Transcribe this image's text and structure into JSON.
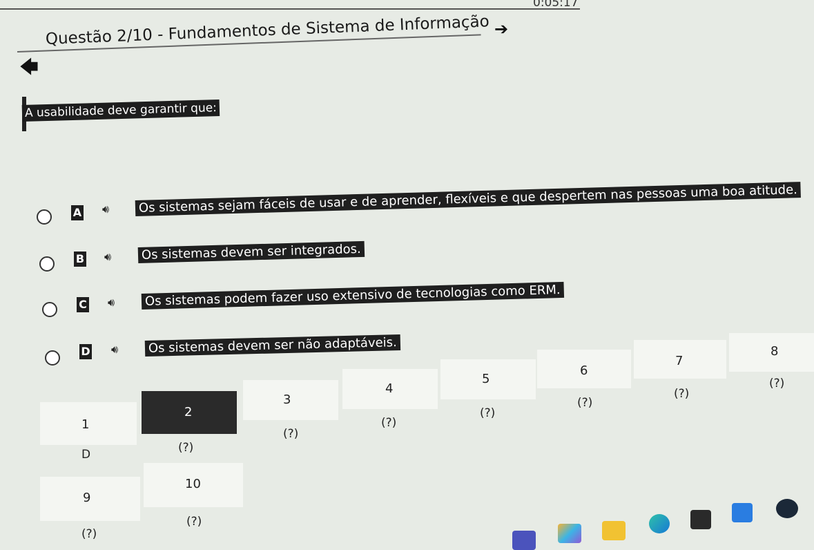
{
  "timer": "0:05:17",
  "header": {
    "title": "Questão 2/10 - Fundamentos de Sistema de Informação",
    "back_icon": "arrow-left-icon",
    "next_icon": "arrow-right-icon"
  },
  "question": {
    "text": "A usabilidade deve garantir que:"
  },
  "options": [
    {
      "letter": "A",
      "text": "Os sistemas sejam fáceis de usar e de aprender, flexíveis e que despertem nas pessoas uma boa atitude."
    },
    {
      "letter": "B",
      "text": "Os sistemas devem ser integrados."
    },
    {
      "letter": "C",
      "text": "Os sistemas podem fazer uso extensivo de tecnologias como ERM."
    },
    {
      "letter": "D",
      "text": "Os sistemas devem ser não adaptáveis."
    }
  ],
  "navigator": {
    "questions": [
      {
        "number": "1",
        "status": "D"
      },
      {
        "number": "2",
        "status": "(?)"
      },
      {
        "number": "3",
        "status": "(?)"
      },
      {
        "number": "4",
        "status": "(?)"
      },
      {
        "number": "5",
        "status": "(?)"
      },
      {
        "number": "6",
        "status": "(?)"
      },
      {
        "number": "7",
        "status": "(?)"
      },
      {
        "number": "8",
        "status": "(?)"
      },
      {
        "number": "9",
        "status": "(?)"
      },
      {
        "number": "10",
        "status": "(?)"
      }
    ],
    "active": "2"
  },
  "taskbar": {
    "icons": [
      "teams-icon",
      "copilot-icon",
      "folder-icon",
      "edge-icon",
      "store-icon",
      "vscode-icon",
      "steam-icon"
    ]
  }
}
